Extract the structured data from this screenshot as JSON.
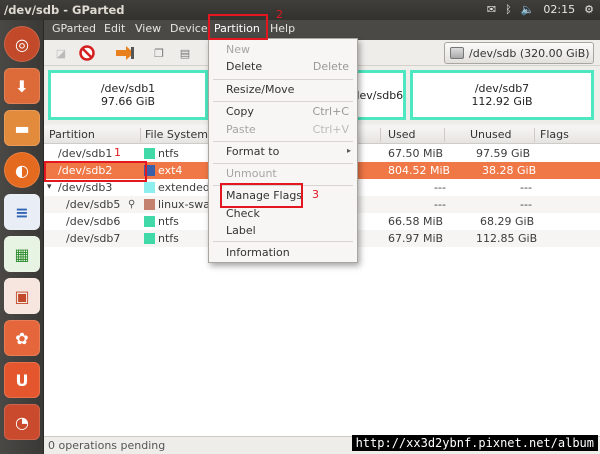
{
  "window": {
    "title": "/dev/sdb - GParted"
  },
  "tray": {
    "clock": "02:15"
  },
  "menubar": {
    "items": [
      "GParted",
      "Edit",
      "View",
      "Device",
      "Partition",
      "Help"
    ]
  },
  "toolbar": {
    "device_selector": "/dev/sdb  (320.00 GiB)"
  },
  "graph": {
    "partitions": [
      {
        "name": "/dev/sdb1",
        "size": "97.66 GiB"
      },
      {
        "name": "/dev/sdb6",
        "size": ""
      },
      {
        "name": "/dev/sdb7",
        "size": "112.92 GiB"
      }
    ]
  },
  "table": {
    "columns": [
      "Partition",
      "File System",
      "Used",
      "Unused",
      "Flags"
    ],
    "rows": [
      {
        "partition": "/dev/sdb1",
        "fs": "ntfs",
        "fs_color": "#42d9a8",
        "used": "67.50 MiB",
        "unused": "97.59 GiB",
        "flags": ""
      },
      {
        "partition": "/dev/sdb2",
        "fs": "ext4",
        "fs_color": "#3b5fa8",
        "used": "804.52 MiB",
        "unused": "38.28 GiB",
        "flags": ""
      },
      {
        "partition": "/dev/sdb3",
        "fs": "extended",
        "fs_color": "#8ef0ee",
        "used": "---",
        "unused": "---",
        "flags": ""
      },
      {
        "partition": "/dev/sdb5",
        "fs": "linux-swap",
        "fs_color": "#c2826f",
        "used": "---",
        "unused": "---",
        "flags": ""
      },
      {
        "partition": "/dev/sdb6",
        "fs": "ntfs",
        "fs_color": "#42d9a8",
        "used": "66.58 MiB",
        "unused": "68.29 GiB",
        "flags": ""
      },
      {
        "partition": "/dev/sdb7",
        "fs": "ntfs",
        "fs_color": "#42d9a8",
        "used": "67.97 MiB",
        "unused": "112.85 GiB",
        "flags": ""
      }
    ]
  },
  "partition_menu": {
    "new": "New",
    "delete": "Delete",
    "delete_accel": "Delete",
    "resize": "Resize/Move",
    "copy": "Copy",
    "copy_accel": "Ctrl+C",
    "paste": "Paste",
    "paste_accel": "Ctrl+V",
    "format": "Format to",
    "unmount": "Unmount",
    "manage_flags": "Manage Flags",
    "check": "Check",
    "label": "Label",
    "information": "Information"
  },
  "annotations": {
    "step1": "1",
    "step2": "2",
    "step3": "3"
  },
  "statusbar": {
    "text": "0 operations pending"
  },
  "watermark": "http://xx3d2ybnf.pixnet.net/album",
  "colors": {
    "accent": "#f07746",
    "annotation_red": "#e3171f"
  }
}
